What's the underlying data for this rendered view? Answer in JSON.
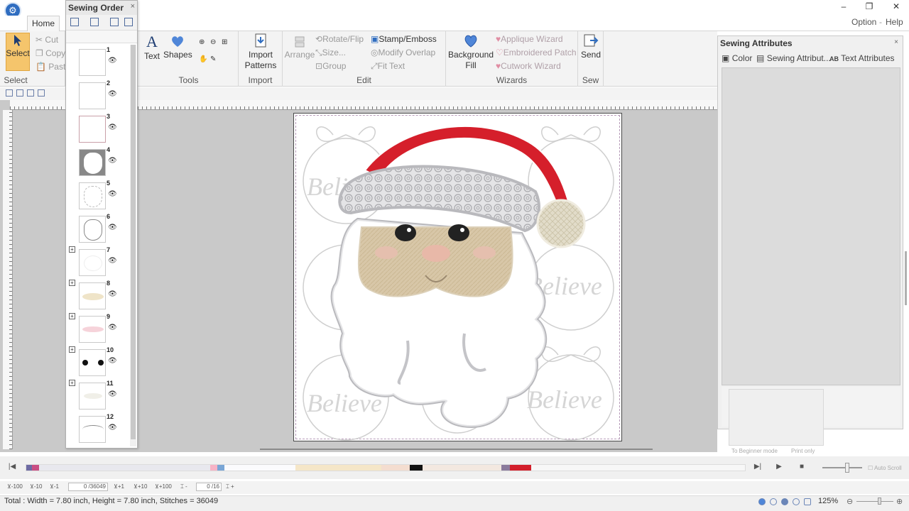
{
  "window": {
    "minimize": "–",
    "restore": "❐",
    "close": "✕"
  },
  "ribbon": {
    "tab_home": "Home",
    "option": "Option",
    "help": "Help",
    "select_group": {
      "select": "Select",
      "cut": "Cut",
      "copy": "Copy",
      "paste": "Paste",
      "label": "Select"
    },
    "tools_group": {
      "text": "Text",
      "shapes": "Shapes",
      "label": "Tools"
    },
    "import_group": {
      "import_patterns_1": "Import",
      "import_patterns_2": "Patterns",
      "label": "Import"
    },
    "edit_group": {
      "arrange": "Arrange",
      "rotate_flip": "Rotate/Flip",
      "size": "Size...",
      "group": "Group",
      "stamp_emboss": "Stamp/Emboss",
      "modify_overlap": "Modify Overlap",
      "fit_text": "Fit Text",
      "label": "Edit"
    },
    "wizards_group": {
      "background_fill_1": "Background",
      "background_fill_2": "Fill",
      "applique": "Applique Wizard",
      "embroidered_patch": "Embroidered Patch",
      "cutwork": "Cutwork Wizard",
      "label": "Wizards"
    },
    "sew_group": {
      "send": "Send",
      "label": "Sew"
    }
  },
  "sewing_order": {
    "title": "Sewing Order",
    "close": "×",
    "items": [
      {
        "num": "1",
        "expand": ""
      },
      {
        "num": "2",
        "expand": ""
      },
      {
        "num": "3",
        "expand": ""
      },
      {
        "num": "4",
        "expand": ""
      },
      {
        "num": "5",
        "expand": ""
      },
      {
        "num": "6",
        "expand": ""
      },
      {
        "num": "7",
        "expand": "+"
      },
      {
        "num": "8",
        "expand": "+"
      },
      {
        "num": "9",
        "expand": "+"
      },
      {
        "num": "10",
        "expand": "+"
      },
      {
        "num": "11",
        "expand": "+"
      },
      {
        "num": "12",
        "expand": ""
      }
    ],
    "eye": "👁"
  },
  "sewing_attributes": {
    "title": "Sewing Attributes",
    "close": "×",
    "tab_color": "Color",
    "tab_sewing": "Sewing Attribut...",
    "tab_text": "Text Attributes",
    "btn_beginner": "To Beginner mode",
    "btn_print": "Print only"
  },
  "design": {
    "believe_text": "Believe"
  },
  "timeline": {
    "colors": [
      "#6d6aa3",
      "#c94e83",
      "#e8e8ee",
      "#f7b3c6",
      "#7aa6d6",
      "#fbfbfd",
      "#f5e6c8",
      "#f4ddd0",
      "#111111",
      "#f3e8e0",
      "#8a7a9c",
      "#d31f2b",
      "#f7f7f7"
    ],
    "first": "|◀",
    "last": "▶|",
    "play": "▶",
    "stop": "■",
    "auto_scroll": "Auto Scroll"
  },
  "bottom_bar": {
    "minus100": "-100",
    "minus10": "-10",
    "minus1": "-1",
    "stitch_pos": "0 /36049",
    "plus1": "+1",
    "plus10": "+10",
    "plus100": "+100",
    "color_pos": "0 /16"
  },
  "status": {
    "text": "Total : Width = 7.80 inch, Height = 7.80 inch, Stitches = 36049",
    "zoom": "125%"
  }
}
